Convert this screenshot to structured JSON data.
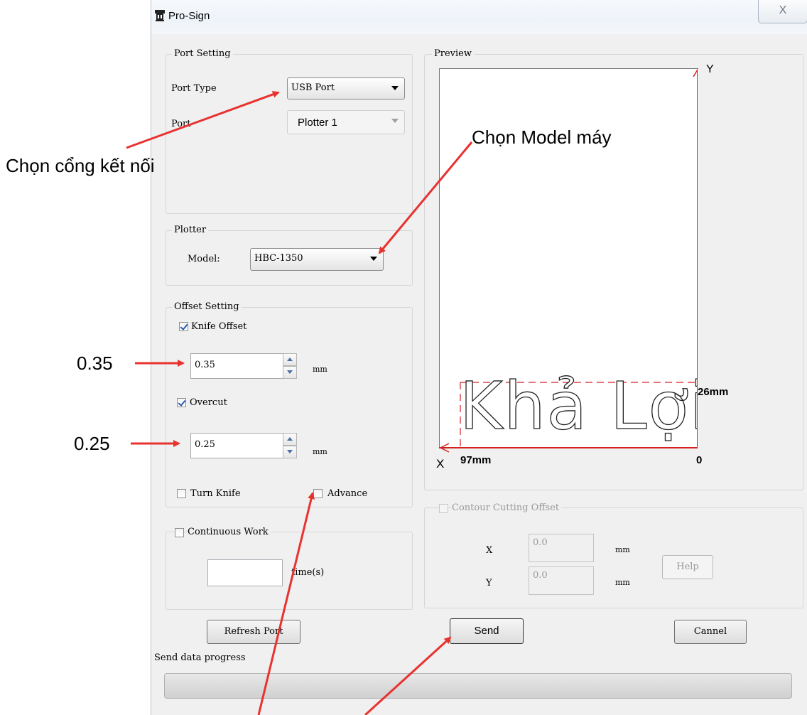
{
  "window": {
    "title": "Pro-Sign",
    "close_glyph": "X"
  },
  "port_setting": {
    "group_label": "Port Setting",
    "port_type_label": "Port Type",
    "port_type_value": "USB Port",
    "port_label": "Port",
    "port_value": "Plotter 1"
  },
  "plotter": {
    "group_label": "Plotter",
    "model_label": "Model:",
    "model_value": "HBC-1350"
  },
  "offset": {
    "group_label": "Offset Setting",
    "knife_offset_label": "Knife Offset",
    "knife_offset_checked": true,
    "knife_offset_value": "0.35",
    "overcut_label": "Overcut",
    "overcut_checked": true,
    "overcut_value": "0.25",
    "unit": "mm",
    "turn_knife_label": "Turn Knife",
    "advance_label": "Advance"
  },
  "continuous": {
    "label": "Continuous Work",
    "value": "",
    "unit": "time(s)"
  },
  "preview": {
    "group_label": "Preview",
    "y_axis": "Y",
    "x_axis": "X",
    "height_label": "26mm",
    "width_label": "97mm",
    "origin_label": "0",
    "sample_text": "Khả Lợi"
  },
  "contour": {
    "label": "Contour Cutting Offset",
    "x_label": "X",
    "x_value": "0.0",
    "y_label": "Y",
    "y_value": "0.0",
    "unit": "mm",
    "help_label": "Help"
  },
  "buttons": {
    "refresh": "Refresh Port",
    "send": "Send",
    "cancel": "Cannel"
  },
  "progress": {
    "label": "Send data progress",
    "value": 0
  },
  "annotations": {
    "port": "Chọn cổng kết nối",
    "model": "Chọn Model máy",
    "knife_offset": "0.35",
    "overcut": "0.25"
  },
  "colors": {
    "arrow": "#e8322f",
    "preview_border": "#d42020"
  }
}
